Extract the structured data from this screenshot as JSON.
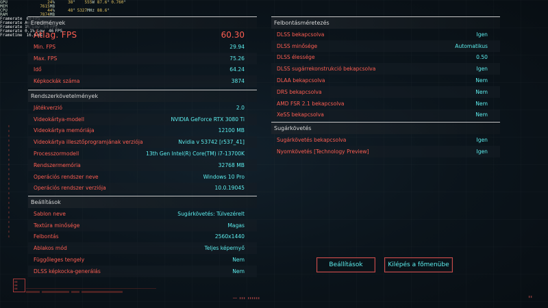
{
  "overlay": {
    "stats": [
      {
        "label": "GPU",
        "v1": "24",
        "v1u": "%",
        "v2": "38",
        "v2u": "°",
        "v3": "555",
        "v3u": "W",
        "v4": "87.6",
        "v4u": "°",
        "v5": "0.760",
        "v5u": "°"
      },
      {
        "label": "MEM",
        "v1": "7615",
        "v1u": "MB"
      },
      {
        "label": "CPU",
        "v1": "44",
        "v1u": "%",
        "v2": "48",
        "v2u": "°",
        "v3": "5327",
        "v3u": "MHz",
        "v4": "88.6",
        "v4u": "°"
      },
      {
        "label": "RAM",
        "v1": "7874",
        "v1u": "MB"
      }
    ],
    "framerate": [
      {
        "label": "Framerate",
        "value": "60",
        "unit": "FPS"
      },
      {
        "label": "Framerate Avg",
        "value": "60",
        "unit": "FPS"
      },
      {
        "label": "Framerate 1% Low",
        "value": "54",
        "unit": "FPS"
      },
      {
        "label": "Framerate 0.1% Low",
        "value": "46",
        "unit": "FPS"
      },
      {
        "label": "Frametime",
        "value": "16.6",
        "unit": "ms"
      }
    ]
  },
  "results": {
    "header": "Eredmények",
    "avg_fps_label": "Átlag. FPS",
    "avg_fps_value": "60.30",
    "rows": [
      {
        "k": "Min. FPS",
        "v": "29.94"
      },
      {
        "k": "Max. FPS",
        "v": "75.26"
      },
      {
        "k": "Idő",
        "v": "64.24"
      },
      {
        "k": "Képkockák száma",
        "v": "3874"
      }
    ]
  },
  "system": {
    "header": "Rendszerkövetelmények",
    "rows": [
      {
        "k": "Játékverzió",
        "v": "2.0"
      },
      {
        "k": "Videokártya-modell",
        "v": "NVIDIA GeForce RTX 3080 Ti"
      },
      {
        "k": "Videokártya memóriája",
        "v": "12100 MB"
      },
      {
        "k": "Videokártya illesztőprogramjának verziója",
        "v": "Nvidia v 53742 [r537_41]"
      },
      {
        "k": "Processzormodell",
        "v": "13th Gen Intel(R) Core(TM) i7-13700K"
      },
      {
        "k": "Rendszermemória",
        "v": "32768 MB"
      },
      {
        "k": "Operációs rendszer neve",
        "v": "Windows 10 Pro"
      },
      {
        "k": "Operációs rendszer verziója",
        "v": "10.0.19045"
      }
    ]
  },
  "settings": {
    "header": "Beállítások",
    "rows": [
      {
        "k": "Sablon neve",
        "v": "Sugárkövetés: Túlvezérelt"
      },
      {
        "k": "Textúra minősége",
        "v": "Magas"
      },
      {
        "k": "Felbontás",
        "v": "2560x1440"
      },
      {
        "k": "Ablakos mód",
        "v": "Teljes képernyő"
      },
      {
        "k": "Függőleges tengely",
        "v": "Nem"
      },
      {
        "k": "DLSS képkocka-generálás",
        "v": "Nem"
      }
    ]
  },
  "upscaling": {
    "header": "Felbontásméretezés",
    "rows": [
      {
        "k": "DLSS bekapcsolva",
        "v": "Igen"
      },
      {
        "k": "DLSS minősége",
        "v": "Automatikus"
      },
      {
        "k": "DLSS élessége",
        "v": "0.50"
      },
      {
        "k": "DLSS sugárrekonstrukció bekapcsolva",
        "v": "Igen"
      },
      {
        "k": "DLAA bekapcsolva",
        "v": "Nem"
      },
      {
        "k": "DRS bekapcsolva",
        "v": "Nem"
      },
      {
        "k": "AMD FSR 2.1 bekapcsolva",
        "v": "Nem"
      },
      {
        "k": "XeSS bekapcsolva",
        "v": "Nem"
      }
    ]
  },
  "raytracing": {
    "header": "Sugárkövetés",
    "rows": [
      {
        "k": "Sugárkövetés bekapcsolva",
        "v": "Igen"
      },
      {
        "k": "Nyomkövetés [Technology Preview]",
        "v": "Igen"
      }
    ]
  },
  "buttons": {
    "settings": "Beállítások",
    "exit": "Kilépés a főmenübe"
  },
  "colors": {
    "key": "#ff5e52",
    "value": "#5ef0f0",
    "border": "#c64a4a"
  }
}
